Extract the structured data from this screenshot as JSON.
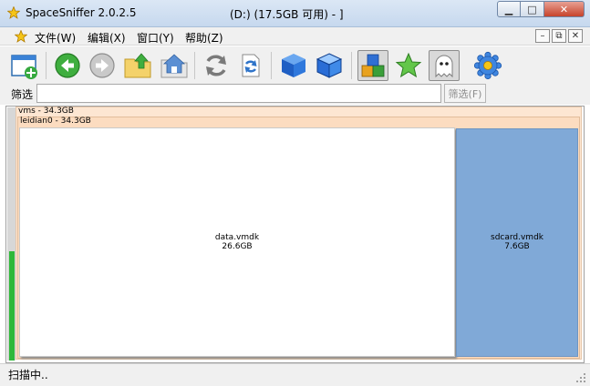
{
  "window": {
    "title": "SpaceSniffer 2.0.2.5",
    "drive_label": "(D:) (17.5GB 可用) - ]",
    "minimize_glyph": "▁",
    "maximize_glyph": "□",
    "close_glyph": "✕"
  },
  "menu": {
    "items": [
      "文件(W)",
      "编辑(X)",
      "窗口(Y)",
      "帮助(Z)"
    ],
    "mdi_minimize": "–",
    "mdi_restore": "⧉",
    "mdi_close": "✕"
  },
  "toolbar": {
    "icons": [
      "new-window-icon",
      "back-icon",
      "forward-icon",
      "up-folder-icon",
      "home-folder-icon",
      "refresh-icon",
      "refresh-document-icon",
      "blue-cube-icon",
      "blue-cube-outline-icon",
      "colored-blocks-icon",
      "star-icon",
      "ghost-icon",
      "settings-gear-icon"
    ],
    "pressed": [
      "colored-blocks-icon",
      "ghost-icon"
    ]
  },
  "filter": {
    "label": "筛选",
    "value": "",
    "placeholder": "",
    "button_label": "筛选(F)"
  },
  "treemap": {
    "root": {
      "name": "vms",
      "size": "34.3GB",
      "label": "vms - 34.3GB"
    },
    "folder": {
      "name": "leidian0",
      "size": "34.3GB",
      "label": "leidian0 - 34.3GB"
    },
    "tiles": [
      {
        "name": "data.vmdk",
        "size": "26.6GB",
        "color": "#ffffff"
      },
      {
        "name": "sdcard.vmdk",
        "size": "7.6GB",
        "color": "#80a9d7"
      }
    ],
    "scan_progress_fraction": 0.43
  },
  "status": {
    "text": "扫描中.."
  }
}
